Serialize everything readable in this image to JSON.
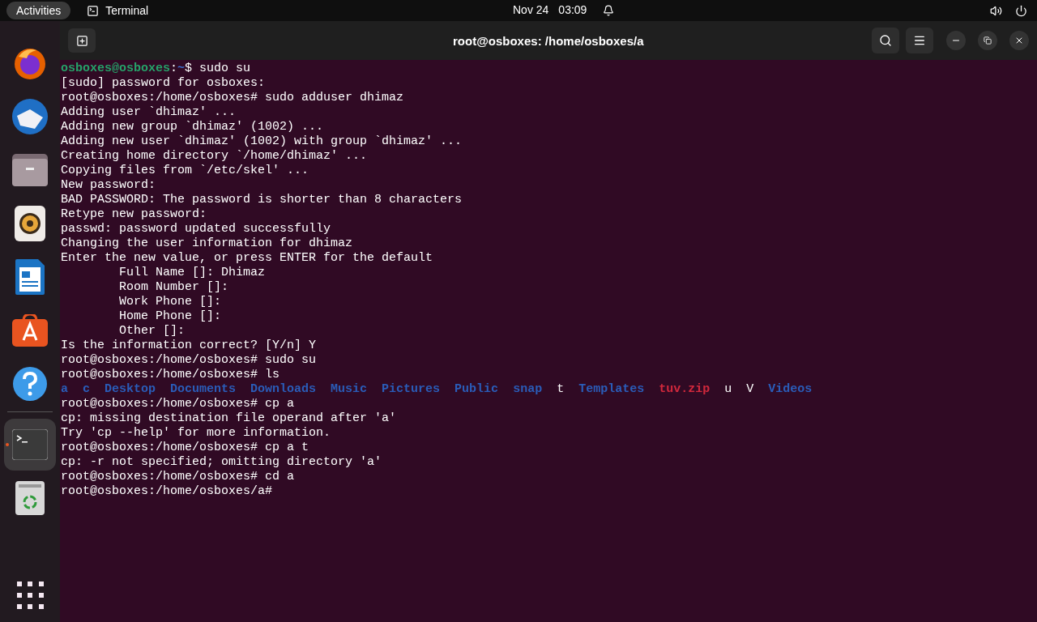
{
  "top_bar": {
    "activities": "Activities",
    "app_name": "Terminal",
    "date": "Nov 24",
    "time": "03:09"
  },
  "dock": [
    {
      "kind": "firefox",
      "running": false
    },
    {
      "kind": "thunderbird",
      "running": false
    },
    {
      "kind": "files",
      "running": false
    },
    {
      "kind": "rhythmbox",
      "running": false
    },
    {
      "kind": "writer",
      "running": false
    },
    {
      "kind": "software",
      "running": false
    },
    {
      "kind": "help",
      "running": false
    },
    {
      "kind": "terminal",
      "running": true
    },
    {
      "kind": "trash",
      "running": false
    }
  ],
  "window": {
    "title": "root@osboxes: /home/osboxes/a"
  },
  "terminal_lines": [
    [
      {
        "kind": "user",
        "text": "osboxes@osboxes"
      },
      {
        "kind": "plain",
        "text": ":"
      },
      {
        "kind": "cwd",
        "text": "~"
      },
      {
        "kind": "plain",
        "text": "$ sudo su"
      }
    ],
    [
      {
        "kind": "plain",
        "text": "[sudo] password for osboxes:"
      }
    ],
    [
      {
        "kind": "plain",
        "text": "root@osboxes:/home/osboxes# sudo adduser dhimaz"
      }
    ],
    [
      {
        "kind": "plain",
        "text": "Adding user `dhimaz' ..."
      }
    ],
    [
      {
        "kind": "plain",
        "text": "Adding new group `dhimaz' (1002) ..."
      }
    ],
    [
      {
        "kind": "plain",
        "text": "Adding new user `dhimaz' (1002) with group `dhimaz' ..."
      }
    ],
    [
      {
        "kind": "plain",
        "text": "Creating home directory `/home/dhimaz' ..."
      }
    ],
    [
      {
        "kind": "plain",
        "text": "Copying files from `/etc/skel' ..."
      }
    ],
    [
      {
        "kind": "plain",
        "text": "New password:"
      }
    ],
    [
      {
        "kind": "plain",
        "text": "BAD PASSWORD: The password is shorter than 8 characters"
      }
    ],
    [
      {
        "kind": "plain",
        "text": "Retype new password:"
      }
    ],
    [
      {
        "kind": "plain",
        "text": "passwd: password updated successfully"
      }
    ],
    [
      {
        "kind": "plain",
        "text": "Changing the user information for dhimaz"
      }
    ],
    [
      {
        "kind": "plain",
        "text": "Enter the new value, or press ENTER for the default"
      }
    ],
    [
      {
        "kind": "plain",
        "text": "        Full Name []: Dhimaz"
      }
    ],
    [
      {
        "kind": "plain",
        "text": "        Room Number []:"
      }
    ],
    [
      {
        "kind": "plain",
        "text": "        Work Phone []:"
      }
    ],
    [
      {
        "kind": "plain",
        "text": "        Home Phone []:"
      }
    ],
    [
      {
        "kind": "plain",
        "text": "        Other []:"
      }
    ],
    [
      {
        "kind": "plain",
        "text": "Is the information correct? [Y/n] Y"
      }
    ],
    [
      {
        "kind": "plain",
        "text": "root@osboxes:/home/osboxes# sudo su"
      }
    ],
    [
      {
        "kind": "plain",
        "text": "root@osboxes:/home/osboxes# ls"
      }
    ],
    [
      {
        "kind": "dir",
        "text": "a"
      },
      {
        "kind": "dir",
        "text": "c"
      },
      {
        "kind": "dir",
        "text": "Desktop"
      },
      {
        "kind": "dir",
        "text": "Documents"
      },
      {
        "kind": "dir",
        "text": "Downloads"
      },
      {
        "kind": "dir",
        "text": "Music"
      },
      {
        "kind": "dir",
        "text": "Pictures"
      },
      {
        "kind": "dir",
        "text": "Public"
      },
      {
        "kind": "dir",
        "text": "snap"
      },
      {
        "kind": "file",
        "text": "t"
      },
      {
        "kind": "dir",
        "text": "Templates"
      },
      {
        "kind": "archive",
        "text": "tuv.zip"
      },
      {
        "kind": "file",
        "text": "u"
      },
      {
        "kind": "file",
        "text": "V"
      },
      {
        "kind": "dir",
        "text": "Videos"
      }
    ],
    [
      {
        "kind": "plain",
        "text": "root@osboxes:/home/osboxes# cp a"
      }
    ],
    [
      {
        "kind": "plain",
        "text": "cp: missing destination file operand after 'a'"
      }
    ],
    [
      {
        "kind": "plain",
        "text": "Try 'cp --help' for more information."
      }
    ],
    [
      {
        "kind": "plain",
        "text": "root@osboxes:/home/osboxes# cp a t"
      }
    ],
    [
      {
        "kind": "plain",
        "text": "cp: -r not specified; omitting directory 'a'"
      }
    ],
    [
      {
        "kind": "plain",
        "text": "root@osboxes:/home/osboxes# cd a"
      }
    ],
    [
      {
        "kind": "plain",
        "text": "root@osboxes:/home/osboxes/a#"
      }
    ]
  ]
}
